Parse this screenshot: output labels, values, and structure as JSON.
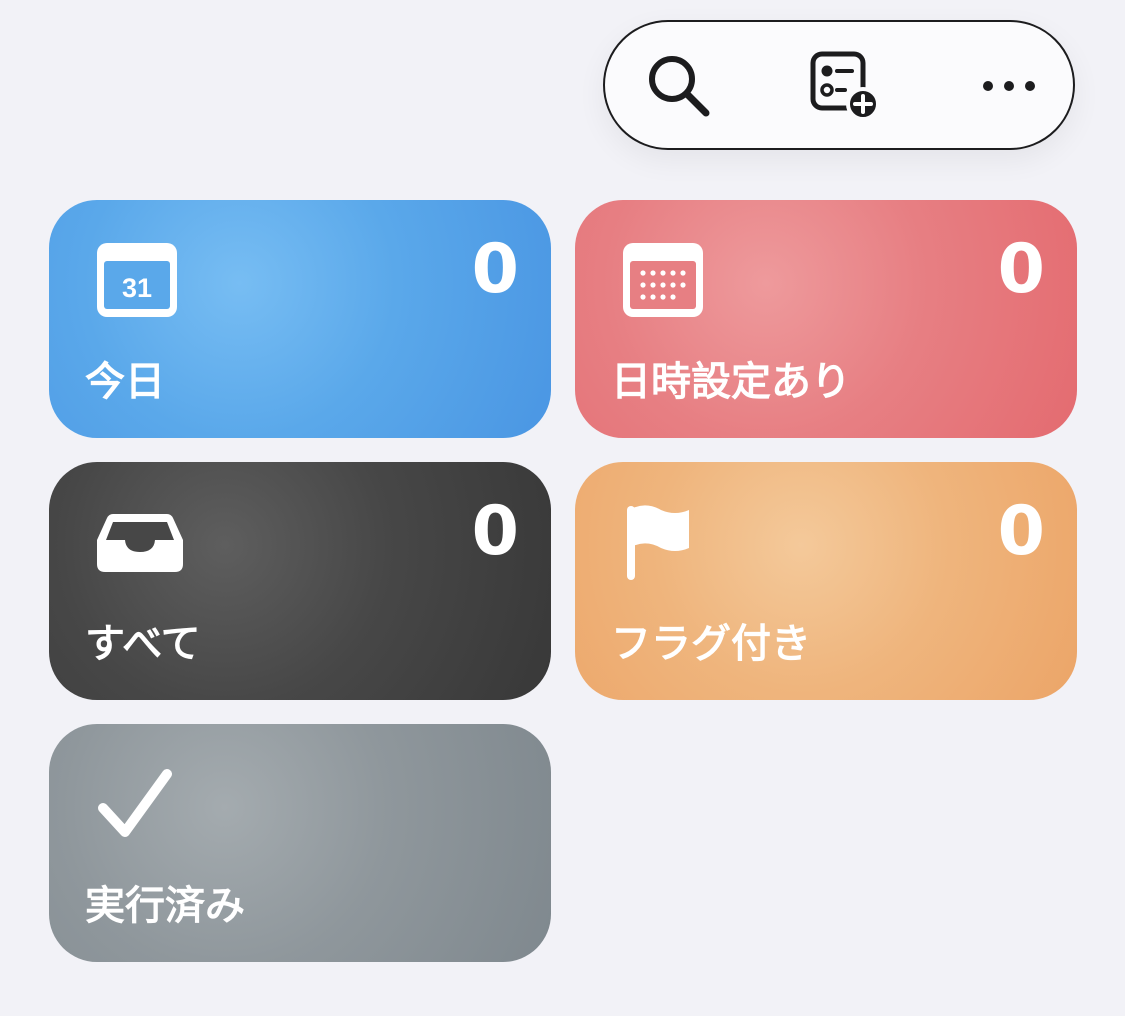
{
  "toolbar": {
    "search_icon": "magnifying-glass-icon",
    "add_list_icon": "list-add-icon",
    "more_icon": "ellipsis-icon"
  },
  "tiles": [
    {
      "id": "today",
      "label": "今日",
      "count": "0",
      "icon": "calendar-day-icon",
      "icon_text": "31",
      "color": "#5aa8ea"
    },
    {
      "id": "scheduled",
      "label": "日時設定あり",
      "count": "0",
      "icon": "calendar-grid-icon",
      "color": "#e77f83"
    },
    {
      "id": "all",
      "label": "すべて",
      "count": "0",
      "icon": "tray-icon",
      "color": "#474747"
    },
    {
      "id": "flagged",
      "label": "フラグ付き",
      "count": "0",
      "icon": "flag-icon",
      "color": "#efb57d"
    },
    {
      "id": "completed",
      "label": "実行済み",
      "icon": "checkmark-icon",
      "color": "#8f979c"
    }
  ]
}
